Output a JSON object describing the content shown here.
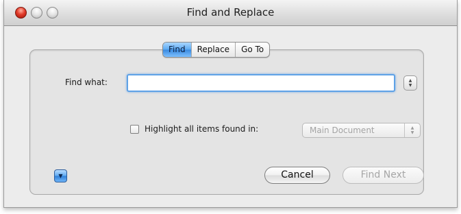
{
  "window": {
    "title": "Find and Replace"
  },
  "tabs": [
    {
      "label": "Find",
      "active": true
    },
    {
      "label": "Replace",
      "active": false
    },
    {
      "label": "Go To",
      "active": false
    }
  ],
  "find": {
    "label": "Find what:",
    "value": ""
  },
  "highlight": {
    "checkbox_label": "Highlight all items found in:",
    "checked": false,
    "scope_value": "Main Document",
    "enabled": false
  },
  "buttons": {
    "cancel": "Cancel",
    "find_next": "Find Next",
    "find_next_enabled": false
  },
  "colors": {
    "accent": "#5aa9f1",
    "close": "#e23c2b",
    "disabled_text": "#a6a6a6"
  },
  "icons": {
    "stepper": "up-down-arrows-icon",
    "disclosure": "disclosure-triangle-down-icon"
  }
}
